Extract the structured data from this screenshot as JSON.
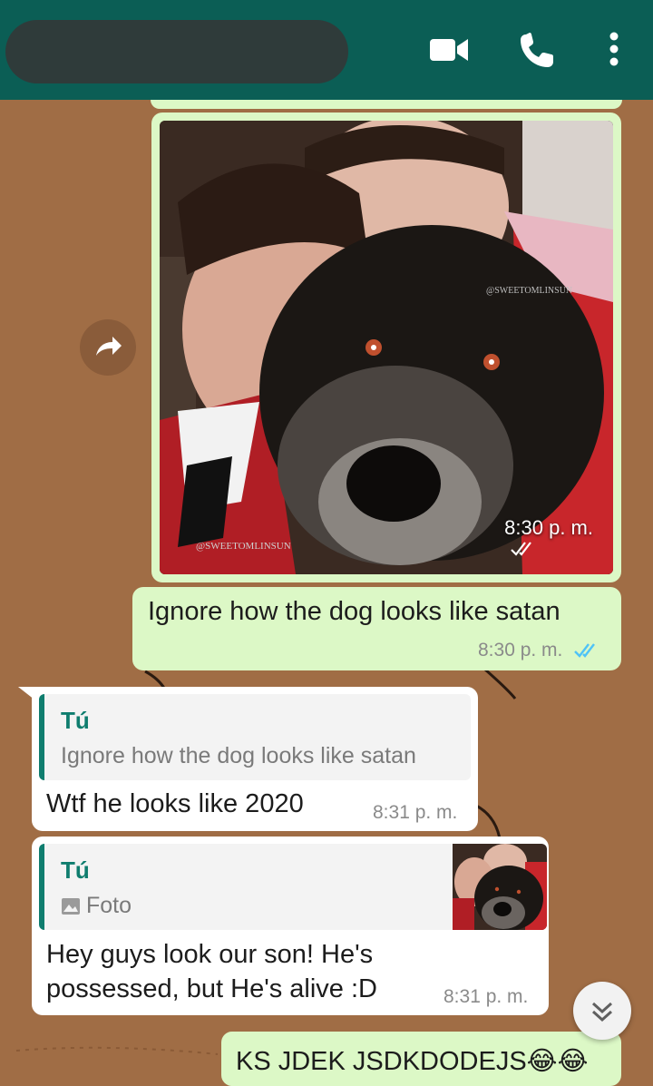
{
  "header": {
    "call_icons": [
      "video-call-icon",
      "voice-call-icon",
      "more-options-icon"
    ]
  },
  "messages": {
    "photo": {
      "time": "8:30 p. m.",
      "watermark_1": "@SWEETOMLINSUN",
      "watermark_2": "@SWEETOMLINSUN"
    },
    "out_1": {
      "text": "Ignore how the dog looks like satan",
      "time": "8:30 p. m."
    },
    "in_1": {
      "quote_author": "Tú",
      "quote_text": "Ignore how the dog looks like satan",
      "text": "Wtf he looks like 2020",
      "time": "8:31 p. m."
    },
    "in_2": {
      "quote_author": "Tú",
      "quote_text": "Foto",
      "text_line1": "Hey guys look our son! He's",
      "text_line2": "possessed, but He's alive :D",
      "time": "8:31 p. m."
    },
    "out_2": {
      "text": "KS JDEK JSDKDODEJS😂😂"
    }
  },
  "colors": {
    "header": "#0b5e55",
    "wallpaper": "#a06d45",
    "outgoing_bubble": "#dcf8c6",
    "incoming_bubble": "#ffffff",
    "quote_accent": "#0f7d6e",
    "read_ticks": "#4fc3f7"
  }
}
